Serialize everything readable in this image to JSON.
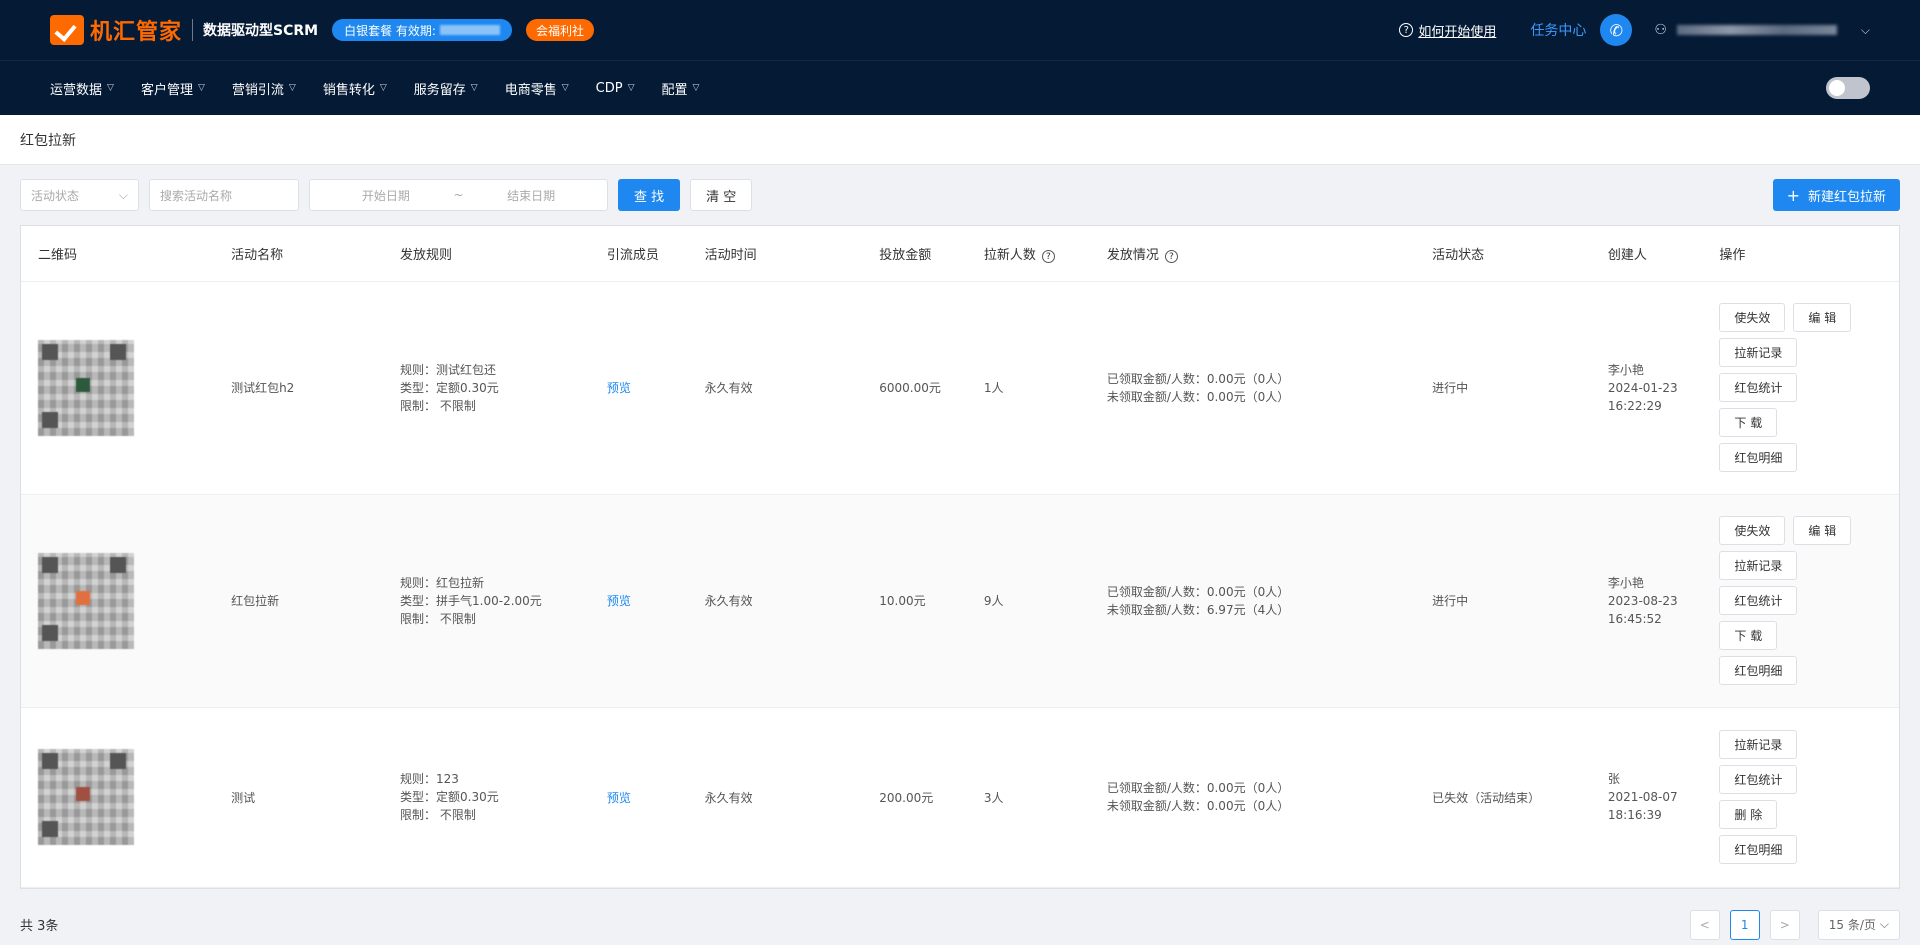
{
  "header": {
    "logo_text": "机汇管家",
    "logo_sub": "数据驱动型SCRM",
    "plan_badge": "白银套餐 有效期:",
    "benefit_badge": "会福利社",
    "help_text": "如何开始使用",
    "task_center": "任务中心",
    "icons": [
      "logo-check-icon",
      "help-icon",
      "phone-icon",
      "user-icon",
      "chevron-down-icon"
    ]
  },
  "nav": {
    "items": [
      "运营数据",
      "客户管理",
      "营销引流",
      "销售转化",
      "服务留存",
      "电商零售",
      "CDP",
      "配置"
    ]
  },
  "breadcrumb": "红包拉新",
  "filters": {
    "status_placeholder": "活动状态",
    "name_placeholder": "搜索活动名称",
    "start_placeholder": "开始日期",
    "range_sep": "~",
    "end_placeholder": "结束日期",
    "search_label": "查 找",
    "clear_label": "清 空",
    "new_label": "新建红包拉新"
  },
  "table": {
    "columns": [
      "二维码",
      "活动名称",
      "发放规则",
      "引流成员",
      "活动时间",
      "投放金额",
      "拉新人数",
      "发放情况",
      "活动状态",
      "创建人",
      "操作"
    ],
    "rows": [
      {
        "name": "测试红包h2",
        "rule": "规则：测试红包还",
        "type": "类型：定额0.30元",
        "limit": "限制：  不限制",
        "member": "预览",
        "time": "永久有效",
        "amount": "6000.00元",
        "count": "1人",
        "claimed": "已领取金额/人数：0.00元（0人）",
        "unclaimed": "未领取金额/人数：0.00元（0人）",
        "status": "进行中",
        "creator": "李小艳",
        "date": "2024-01-23",
        "clock": "16:22:29",
        "ops": [
          "使失效",
          "编 辑",
          "拉新记录",
          "红包统计",
          "下 载",
          "红包明细"
        ]
      },
      {
        "name": "红包拉新",
        "rule": "规则：红包拉新",
        "type": "类型：拼手气1.00-2.00元",
        "limit": "限制：  不限制",
        "member": "预览",
        "time": "永久有效",
        "amount": "10.00元",
        "count": "9人",
        "claimed": "已领取金额/人数：0.00元（0人）",
        "unclaimed": "未领取金额/人数：6.97元（4人）",
        "status": "进行中",
        "creator": "李小艳",
        "date": "2023-08-23",
        "clock": "16:45:52",
        "ops": [
          "使失效",
          "编 辑",
          "拉新记录",
          "红包统计",
          "下 载",
          "红包明细"
        ]
      },
      {
        "name": "测试",
        "rule": "规则：123",
        "type": "类型：定额0.30元",
        "limit": "限制：  不限制",
        "member": "预览",
        "time": "永久有效",
        "amount": "200.00元",
        "count": "3人",
        "claimed": "已领取金额/人数：0.00元（0人）",
        "unclaimed": "未领取金额/人数：0.00元（0人）",
        "status": "已失效（活动结束）",
        "creator": "张",
        "date": "2021-08-07",
        "clock": "18:16:39",
        "ops": [
          "拉新记录",
          "红包统计",
          "删 除",
          "红包明细"
        ]
      }
    ]
  },
  "footer": {
    "total": "共 3条",
    "prev": "<",
    "page": "1",
    "next": ">",
    "page_size": "15 条/页"
  },
  "colors": {
    "topbar": "#051a35",
    "primary": "#1e88f0",
    "accent": "#ff6a00"
  }
}
